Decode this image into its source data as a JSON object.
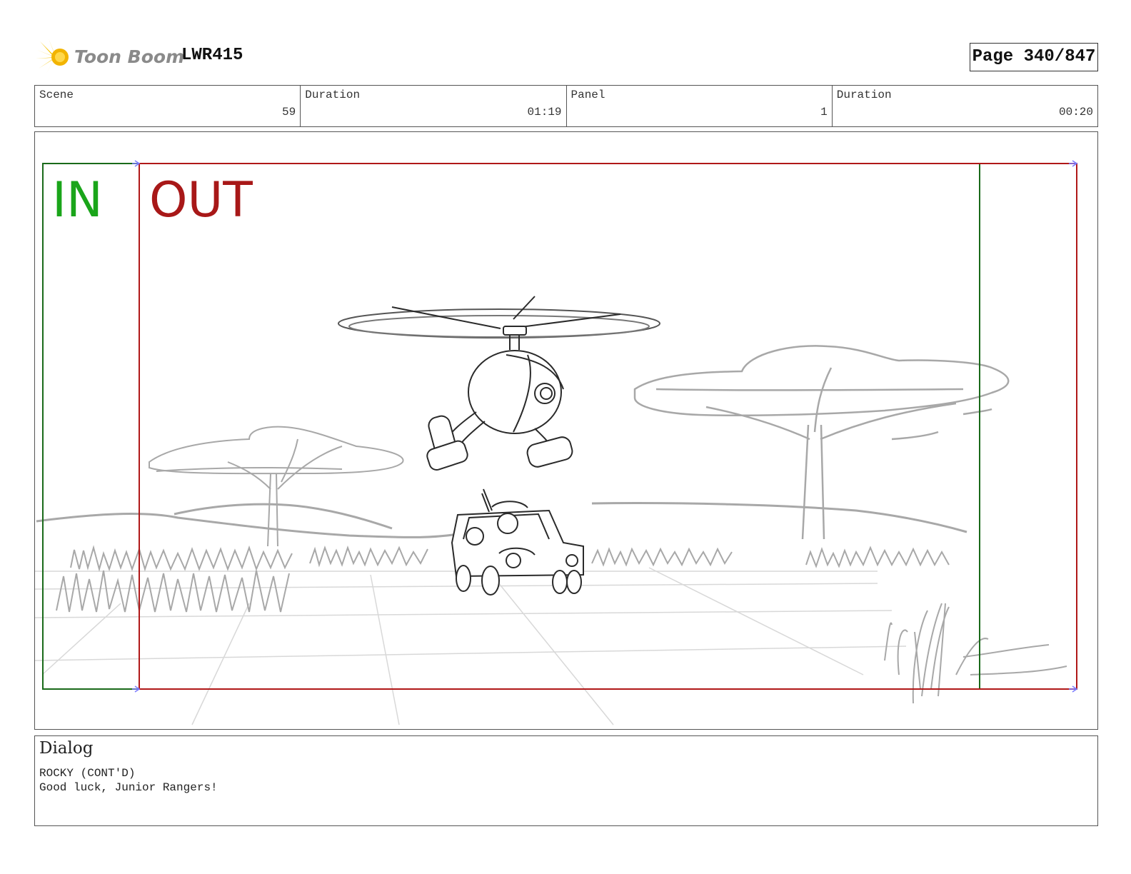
{
  "header": {
    "logo_text": "Toon Boom",
    "project_code": "LWR415",
    "page_label": "Page 340/847"
  },
  "info": {
    "scene_label": "Scene",
    "scene_value": "59",
    "scene_duration_label": "Duration",
    "scene_duration_value": "01:19",
    "panel_label": "Panel",
    "panel_value": "1",
    "panel_duration_label": "Duration",
    "panel_duration_value": "00:20"
  },
  "frame": {
    "in_label": "IN",
    "out_label": "OUT",
    "in_color": "#1aa51a",
    "out_color": "#a81818"
  },
  "dialog": {
    "title": "Dialog",
    "character": "ROCKY (CONT'D)",
    "line": "Good luck, Junior Rangers!"
  }
}
